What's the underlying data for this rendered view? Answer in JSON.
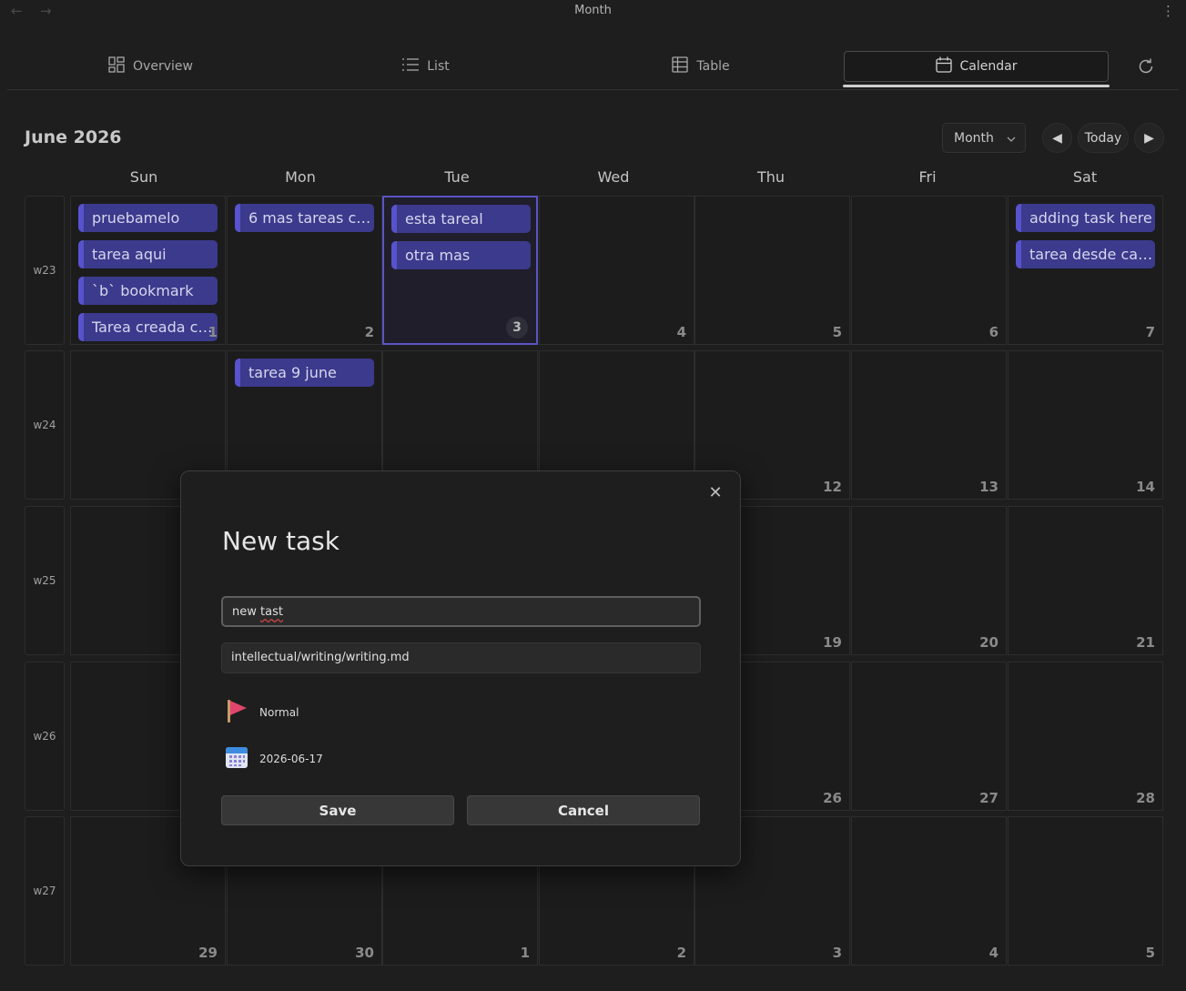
{
  "window": {
    "title": "Month"
  },
  "tabs": [
    {
      "label": "Overview",
      "icon": "grid-icon"
    },
    {
      "label": "List",
      "icon": "list-icon"
    },
    {
      "label": "Table",
      "icon": "table-icon"
    },
    {
      "label": "Calendar",
      "icon": "calendar-icon",
      "active": true
    }
  ],
  "calendar": {
    "title": "June 2026",
    "view": "Month",
    "today_label": "Today",
    "weekdays": [
      "Sun",
      "Mon",
      "Tue",
      "Wed",
      "Thu",
      "Fri",
      "Sat"
    ],
    "weeks": [
      {
        "label": "w23",
        "days": [
          {
            "num": "1",
            "events": [
              "pruebamelo",
              "tarea aqui",
              "`b` bookmark",
              "Tarea creada co..."
            ]
          },
          {
            "num": "2",
            "events": [
              "6 mas tareas co..."
            ]
          },
          {
            "num": "3",
            "selected": true,
            "events": [
              "esta tareal",
              "otra mas"
            ]
          },
          {
            "num": "4",
            "events": []
          },
          {
            "num": "5",
            "events": []
          },
          {
            "num": "6",
            "events": []
          },
          {
            "num": "7",
            "events": [
              "adding task here",
              "tarea desde cale..."
            ]
          }
        ]
      },
      {
        "label": "w24",
        "days": [
          {
            "num": "",
            "events": []
          },
          {
            "num": "",
            "events": [
              "tarea 9 june"
            ]
          },
          {
            "num": "",
            "events": []
          },
          {
            "num": "",
            "events": []
          },
          {
            "num": "12",
            "events": []
          },
          {
            "num": "13",
            "events": []
          },
          {
            "num": "14",
            "events": []
          }
        ]
      },
      {
        "label": "w25",
        "days": [
          {
            "num": "",
            "events": []
          },
          {
            "num": "",
            "events": []
          },
          {
            "num": "",
            "events": []
          },
          {
            "num": "",
            "events": []
          },
          {
            "num": "19",
            "events": []
          },
          {
            "num": "20",
            "events": []
          },
          {
            "num": "21",
            "events": []
          }
        ]
      },
      {
        "label": "w26",
        "days": [
          {
            "num": "",
            "events": []
          },
          {
            "num": "",
            "events": []
          },
          {
            "num": "",
            "events": []
          },
          {
            "num": "",
            "events": []
          },
          {
            "num": "26",
            "events": []
          },
          {
            "num": "27",
            "events": []
          },
          {
            "num": "28",
            "events": []
          }
        ]
      },
      {
        "label": "w27",
        "days": [
          {
            "num": "29",
            "events": []
          },
          {
            "num": "30",
            "events": []
          },
          {
            "num": "1",
            "events": []
          },
          {
            "num": "2",
            "events": []
          },
          {
            "num": "3",
            "events": []
          },
          {
            "num": "4",
            "events": []
          },
          {
            "num": "5",
            "events": []
          }
        ]
      }
    ]
  },
  "modal": {
    "title": "New task",
    "task_name_prefix": "new ",
    "task_name_typo": "tast",
    "file_path": "intellectual/writing/writing.md",
    "priority": {
      "label": "Normal",
      "icon": "flag-icon",
      "color": "#e0466a"
    },
    "due_date": {
      "value": "2026-06-17",
      "icon": "calendar-date-icon"
    },
    "save_label": "Save",
    "cancel_label": "Cancel"
  },
  "colors": {
    "background": "#1e1e1e",
    "event_fill": "#3b3a8c",
    "event_accent": "#5753cc",
    "selected_border": "#5a55c4"
  }
}
